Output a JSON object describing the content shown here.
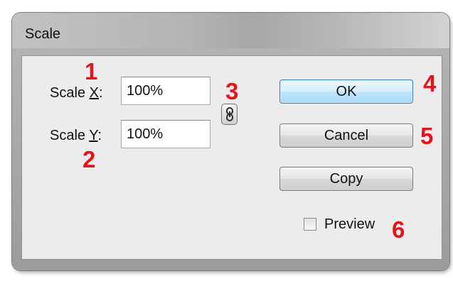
{
  "window": {
    "title": "Scale"
  },
  "scale_x": {
    "label_prefix": "Scale ",
    "label_accel": "X",
    "label_suffix": ":",
    "value": "100%"
  },
  "scale_y": {
    "label_prefix": "Scale ",
    "label_accel": "Y",
    "label_suffix": ":",
    "value": "100%"
  },
  "constrain_button": {
    "icon": "chain-link-icon"
  },
  "buttons": {
    "ok": "OK",
    "cancel": "Cancel",
    "copy": "Copy"
  },
  "preview": {
    "label": "Preview",
    "checked": false
  },
  "annotations": [
    "1",
    "2",
    "3",
    "4",
    "5",
    "6"
  ],
  "colors": {
    "annotation": "#e3141b",
    "default_button": "#bee6fd"
  }
}
